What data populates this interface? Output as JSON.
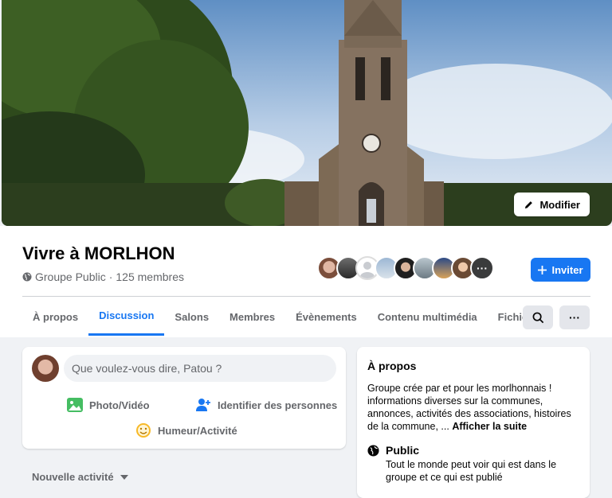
{
  "cover": {
    "edit_label": "Modifier"
  },
  "group": {
    "title": "Vivre à MORLHON",
    "privacy": "Groupe Public",
    "separator": "·",
    "members": "125 membres",
    "invite_label": "Inviter",
    "more_members_glyph": "···"
  },
  "tabs": [
    {
      "label": "À propos"
    },
    {
      "label": "Discussion",
      "active": true
    },
    {
      "label": "Salons"
    },
    {
      "label": "Membres"
    },
    {
      "label": "Évènements"
    },
    {
      "label": "Contenu multimédia"
    },
    {
      "label": "Fichiers"
    }
  ],
  "toolbar": {
    "more_glyph": "···"
  },
  "composer": {
    "placeholder": "Que voulez-vous dire, Patou ?",
    "photo_label": "Photo/Vidéo",
    "tag_label": "Identifier des personnes",
    "mood_label": "Humeur/Activité"
  },
  "feed": {
    "sort_label": "Nouvelle activité"
  },
  "about": {
    "title": "À propos",
    "description": "Groupe crée par et pour les morlhonnais ! informations diverses sur la communes, annonces, activités des associations, histoires de la commune, ...",
    "see_more": "Afficher la suite",
    "public_title": "Public",
    "public_desc": "Tout le monde peut voir qui est dans le groupe et ce qui est publié"
  },
  "colors": {
    "accent": "#1877f2",
    "background": "#f0f2f5",
    "muted_text": "#65676b"
  },
  "icons": [
    "pencil-icon",
    "globe-icon",
    "plus-icon",
    "search-icon",
    "more-icon",
    "photo-icon",
    "tag-person-icon",
    "smiley-icon",
    "caret-down-icon"
  ]
}
